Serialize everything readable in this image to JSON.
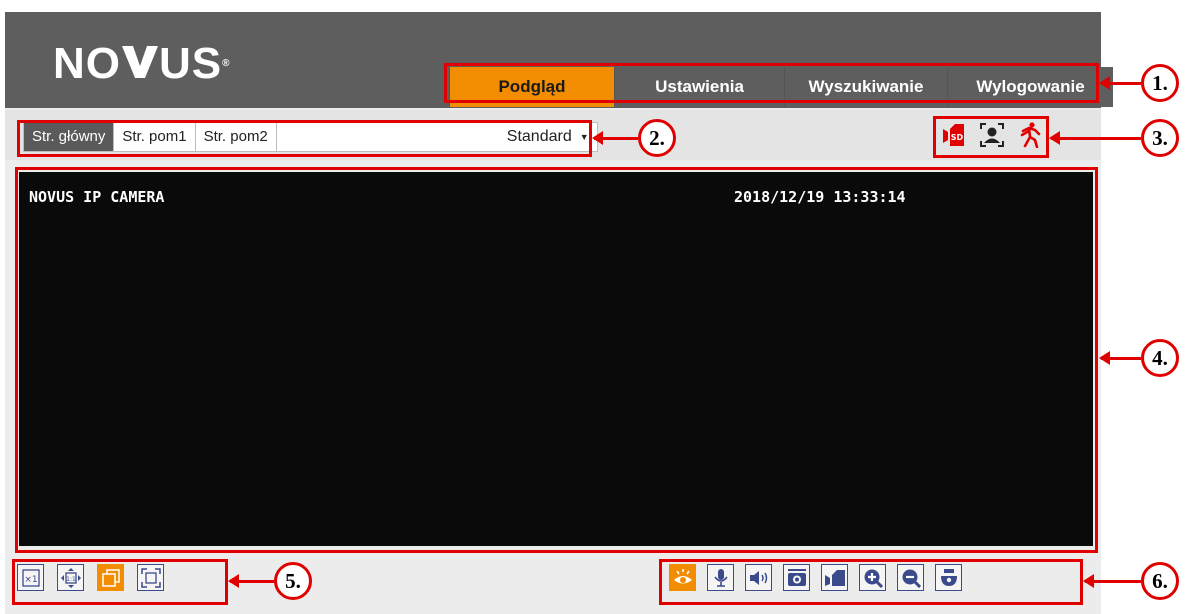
{
  "brand": {
    "logo_pre": "NO",
    "logo_post": "US",
    "registered": "®"
  },
  "nav": {
    "tabs": [
      "Podgląd",
      "Ustawienia",
      "Wyszukiwanie",
      "Wylogowanie"
    ],
    "active": "Podgląd"
  },
  "streams": {
    "main": "Str. główny",
    "sub1": "Str. pom1",
    "sub2": "Str. pom2",
    "mode": "Standard"
  },
  "status_icons": [
    "sd-record-icon",
    "face-detect-icon",
    "motion-person-icon"
  ],
  "video": {
    "camera_name": "NOVUS IP CAMERA",
    "timestamp": "2018/12/19 13:33:14"
  },
  "left_tools": [
    "original-size-icon",
    "fit-window-icon",
    "multi-window-icon",
    "fullscreen-icon"
  ],
  "right_tools": [
    "live-view-icon",
    "microphone-icon",
    "speaker-icon",
    "snapshot-icon",
    "record-icon",
    "zoom-in-icon",
    "zoom-out-icon",
    "ptz-icon"
  ],
  "callouts": [
    "1.",
    "2.",
    "3.",
    "4.",
    "5.",
    "6."
  ],
  "colors": {
    "accent": "#f28c00",
    "header": "#5e5e5e",
    "annotation": "#e00000",
    "icon_blue": "#3b4a8a"
  }
}
